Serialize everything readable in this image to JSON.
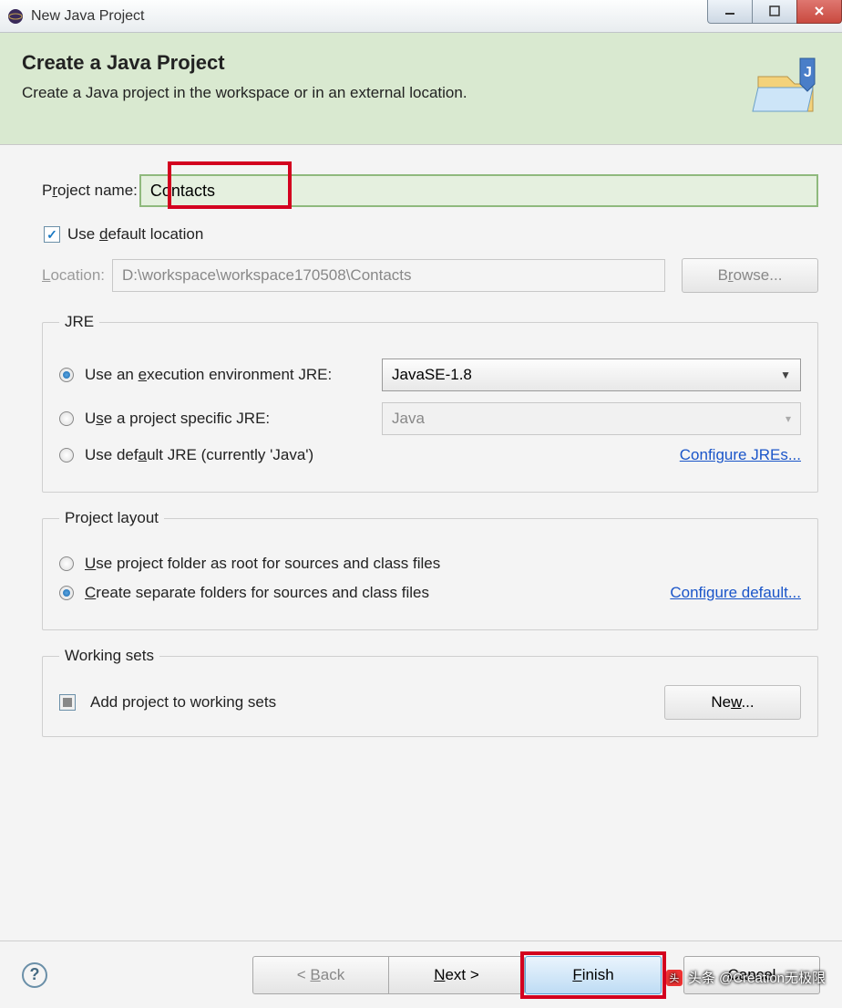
{
  "window": {
    "title": "New Java Project"
  },
  "banner": {
    "heading": "Create a Java Project",
    "sub": "Create a Java project in the workspace or in an external location."
  },
  "project": {
    "name_label_pre": "P",
    "name_label_u": "r",
    "name_label_post": "oject name:",
    "name_value": "Contacts"
  },
  "location": {
    "use_default_pre": "Use ",
    "use_default_u": "d",
    "use_default_post": "efault location",
    "label_u": "L",
    "label_post": "ocation:",
    "value": "D:\\workspace\\workspace170508\\Contacts",
    "browse_pre": "B",
    "browse_u": "r",
    "browse_post": "owse..."
  },
  "jre": {
    "legend": "JRE",
    "opt1_pre": "Use an ",
    "opt1_u": "e",
    "opt1_post": "xecution environment JRE:",
    "opt1_value": "JavaSE-1.8",
    "opt2_pre": "U",
    "opt2_u": "s",
    "opt2_post": "e a project specific JRE:",
    "opt2_value": "Java",
    "opt3_pre": "Use def",
    "opt3_u": "a",
    "opt3_post": "ult JRE (currently 'Java')",
    "configure": "Configure JREs..."
  },
  "layout": {
    "legend": "Project layout",
    "opt1_u": "U",
    "opt1_post": "se project folder as root for sources and class files",
    "opt2_u": "C",
    "opt2_post": "reate separate folders for sources and class files",
    "configure": "Configure default..."
  },
  "ws": {
    "legend": "Working sets",
    "add_label": "Add project to working sets",
    "new_pre": "Ne",
    "new_u": "w",
    "new_post": "..."
  },
  "footer": {
    "back_pre": "< ",
    "back_u": "B",
    "back_post": "ack",
    "next_u": "N",
    "next_post": "ext >",
    "finish_u": "F",
    "finish_post": "inish",
    "cancel": "Cancel"
  },
  "watermark": "头条 @Creation无极限"
}
